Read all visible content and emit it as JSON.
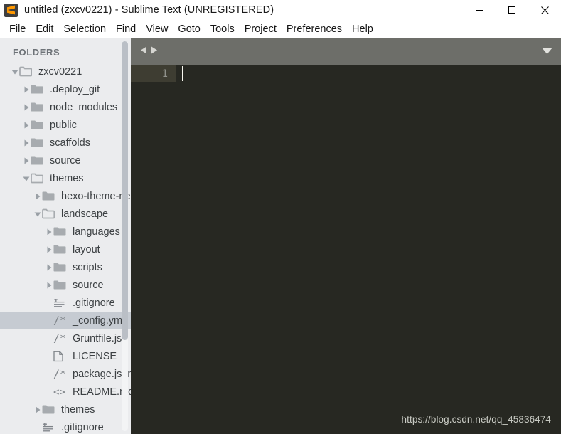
{
  "window": {
    "title": "untitled (zxcv0221) - Sublime Text (UNREGISTERED)",
    "app_icon": "sublime-text-icon",
    "minimize_label": "—",
    "maximize_label": "□",
    "close_label": "✕"
  },
  "menubar": {
    "items": [
      {
        "label": "File"
      },
      {
        "label": "Edit"
      },
      {
        "label": "Selection"
      },
      {
        "label": "Find"
      },
      {
        "label": "View"
      },
      {
        "label": "Goto"
      },
      {
        "label": "Tools"
      },
      {
        "label": "Project"
      },
      {
        "label": "Preferences"
      },
      {
        "label": "Help"
      }
    ]
  },
  "sidebar": {
    "header": "FOLDERS",
    "items": [
      {
        "label": "zxcv0221",
        "level": 0,
        "type": "folder",
        "state": "open",
        "icon": "folder-open-icon",
        "selected": false
      },
      {
        "label": ".deploy_git",
        "level": 1,
        "type": "folder",
        "state": "closed",
        "icon": "folder-icon",
        "selected": false
      },
      {
        "label": "node_modules",
        "level": 1,
        "type": "folder",
        "state": "closed",
        "icon": "folder-icon",
        "selected": false
      },
      {
        "label": "public",
        "level": 1,
        "type": "folder",
        "state": "closed",
        "icon": "folder-icon",
        "selected": false
      },
      {
        "label": "scaffolds",
        "level": 1,
        "type": "folder",
        "state": "closed",
        "icon": "folder-icon",
        "selected": false
      },
      {
        "label": "source",
        "level": 1,
        "type": "folder",
        "state": "closed",
        "icon": "folder-icon",
        "selected": false
      },
      {
        "label": "themes",
        "level": 1,
        "type": "folder",
        "state": "open",
        "icon": "folder-open-icon",
        "selected": false
      },
      {
        "label": "hexo-theme-next",
        "level": 2,
        "type": "folder",
        "state": "closed",
        "icon": "folder-icon",
        "selected": false
      },
      {
        "label": "landscape",
        "level": 2,
        "type": "folder",
        "state": "open",
        "icon": "folder-open-icon",
        "selected": false
      },
      {
        "label": "languages",
        "level": 3,
        "type": "folder",
        "state": "closed",
        "icon": "folder-icon",
        "selected": false
      },
      {
        "label": "layout",
        "level": 3,
        "type": "folder",
        "state": "closed",
        "icon": "folder-icon",
        "selected": false
      },
      {
        "label": "scripts",
        "level": 3,
        "type": "folder",
        "state": "closed",
        "icon": "folder-icon",
        "selected": false
      },
      {
        "label": "source",
        "level": 3,
        "type": "folder",
        "state": "closed",
        "icon": "folder-icon",
        "selected": false
      },
      {
        "label": ".gitignore",
        "level": 3,
        "type": "file",
        "state": "none",
        "icon": "text-file-icon",
        "selected": false
      },
      {
        "label": "_config.yml",
        "level": 3,
        "type": "file",
        "state": "none",
        "icon": "comment-file-icon",
        "selected": true
      },
      {
        "label": "Gruntfile.js",
        "level": 3,
        "type": "file",
        "state": "none",
        "icon": "comment-file-icon",
        "selected": false
      },
      {
        "label": "LICENSE",
        "level": 3,
        "type": "file",
        "state": "none",
        "icon": "blank-file-icon",
        "selected": false
      },
      {
        "label": "package.json",
        "level": 3,
        "type": "file",
        "state": "none",
        "icon": "comment-file-icon",
        "selected": false
      },
      {
        "label": "README.md",
        "level": 3,
        "type": "file",
        "state": "none",
        "icon": "markup-file-icon",
        "selected": false
      },
      {
        "label": "themes",
        "level": 2,
        "type": "folder",
        "state": "closed",
        "icon": "folder-icon",
        "selected": false
      },
      {
        "label": ".gitignore",
        "level": 2,
        "type": "file",
        "state": "none",
        "icon": "text-file-icon",
        "selected": false
      }
    ]
  },
  "editor": {
    "tabbar": {
      "prev_icon": "arrow-left-icon",
      "next_icon": "arrow-right-icon",
      "menu_icon": "chevron-down-icon"
    },
    "line_numbers": [
      "1"
    ],
    "content": "",
    "watermark": "https://blog.csdn.net/qq_45836474"
  },
  "colors": {
    "sidebar_bg": "#ebecee",
    "sidebar_selected": "#c6cbd2",
    "tabbar_bg": "#6d6e69",
    "editor_bg": "#272822",
    "gutter_active_bg": "#3e3d32",
    "accent_orange": "#ff9800"
  }
}
